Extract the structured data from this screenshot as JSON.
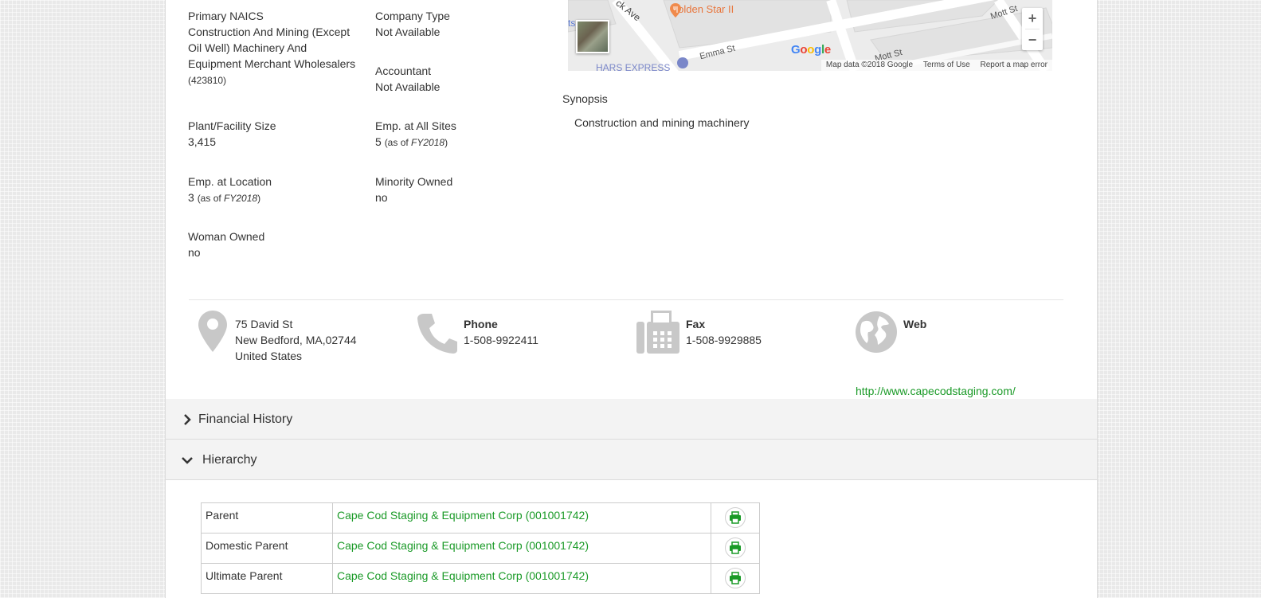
{
  "details": {
    "col1": [
      {
        "label": "Primary NAICS",
        "value": "Construction And Mining (Except Oil Well) Machinery And Equipment Merchant Wholesalers",
        "code": "(423810)"
      },
      {
        "label": "Plant/Facility Size",
        "value": "3,415"
      },
      {
        "label": "Emp. at Location",
        "value": "3",
        "as_of_prefix": "(as of ",
        "as_of_year": "FY2018",
        "as_of_suffix": ")"
      },
      {
        "label": "Woman Owned",
        "value": "no"
      }
    ],
    "col2": [
      {
        "label": "Company Type",
        "value": "Not Available"
      },
      {
        "label": "Accountant",
        "value": "Not Available"
      },
      {
        "label": "Emp. at All Sites",
        "value": "5",
        "as_of_prefix": "(as of ",
        "as_of_year": "FY2018",
        "as_of_suffix": ")"
      },
      {
        "label": "Minority Owned",
        "value": "no"
      }
    ]
  },
  "map": {
    "labels": {
      "restaurant": "Golden Star II",
      "street_emma": "Emma St",
      "street_mott_1": "Mott St",
      "street_mott_2": "Mott St",
      "street_ave": "ck Ave",
      "business": "HARS EXPRESS",
      "edge": "ts"
    },
    "logo": "Google",
    "footer": {
      "data": "Map data ©2018 Google",
      "terms": "Terms of Use",
      "report": "Report a map error"
    },
    "zoom_in": "+",
    "zoom_out": "−"
  },
  "synopsis": {
    "label": "Synopsis",
    "text": "Construction and mining machinery"
  },
  "contact": {
    "address": {
      "line1": "75 David St",
      "line2": "New Bedford, MA,02744",
      "line3": "United States"
    },
    "phone": {
      "title": "Phone",
      "value": "1-508-9922411"
    },
    "fax": {
      "title": "Fax",
      "value": "1-508-9929885"
    },
    "web": {
      "title": "Web",
      "url": "http://www.capecodstaging.com/"
    }
  },
  "sections": {
    "financial_history": "Financial History",
    "hierarchy": "Hierarchy"
  },
  "hierarchy_rows": [
    {
      "label": "Parent",
      "link": "Cape Cod Staging & Equipment Corp (001001742)"
    },
    {
      "label": "Domestic Parent",
      "link": "Cape Cod Staging & Equipment Corp (001001742)"
    },
    {
      "label": "Ultimate Parent",
      "link": "Cape Cod Staging & Equipment Corp (001001742)"
    }
  ],
  "colors": {
    "link_green": "#1a9a27",
    "icon_gray": "#c8c8c8"
  }
}
